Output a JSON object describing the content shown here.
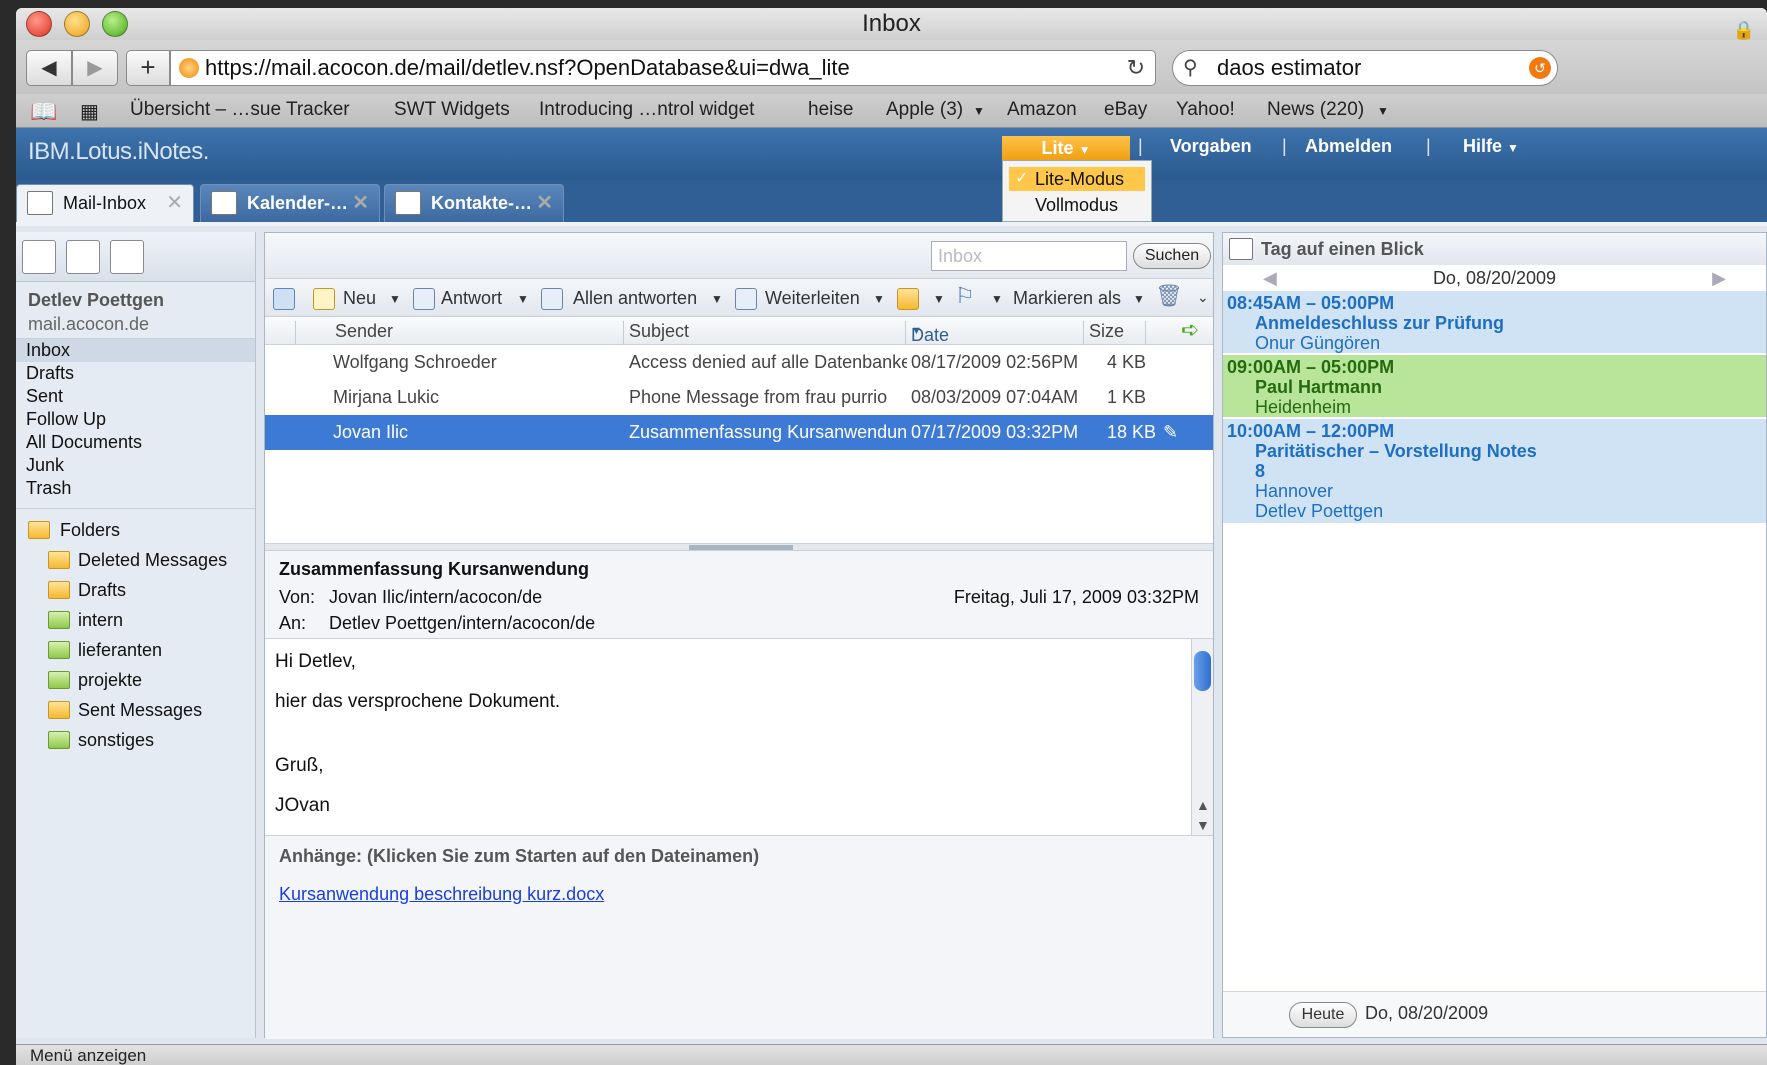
{
  "window": {
    "title": "Inbox"
  },
  "browser": {
    "url": "https://mail.acocon.de/mail/detlev.nsf?OpenDatabase&ui=dwa_lite",
    "search": "daos estimator",
    "bookmarks": [
      "Übersicht – …sue Tracker",
      "SWT Widgets",
      "Introducing …ntrol widget",
      "heise",
      "Apple (3)",
      "Amazon",
      "eBay",
      "Yahoo!",
      "News (220)"
    ]
  },
  "app": {
    "logo": "IBM.Lotus.iNotes.",
    "lite": "Lite",
    "links": {
      "vorgaben": "Vorgaben",
      "abmelden": "Abmelden",
      "hilfe": "Hilfe"
    },
    "lite_menu": {
      "opt1": "Lite-Modus",
      "opt2": "Vollmodus"
    },
    "tabs": [
      "Mail-Inbox",
      "Kalender-…",
      "Kontakte-…"
    ]
  },
  "user": {
    "name": "Detlev Poettgen",
    "domain": "mail.acocon.de"
  },
  "nav": [
    "Inbox",
    "Drafts",
    "Sent",
    "Follow Up",
    "All Documents",
    "Junk",
    "Trash"
  ],
  "folders": {
    "header": "Folders",
    "items": [
      "Deleted Messages",
      "Drafts",
      "intern",
      "lieferanten",
      "projekte",
      "Sent Messages",
      "sonstiges"
    ]
  },
  "search": {
    "placeholder": "Inbox",
    "button": "Suchen"
  },
  "actions": {
    "neu": "Neu",
    "antwort": "Antwort",
    "allen": "Allen antworten",
    "weiter": "Weiterleiten",
    "markieren": "Markieren als"
  },
  "columns": {
    "sender": "Sender",
    "subject": "Subject",
    "date": "Date",
    "size": "Size"
  },
  "messages": [
    {
      "sender": "Wolfgang Schroeder",
      "subject": "Access denied auf alle Datenbanke",
      "date": "08/17/2009 02:56PM",
      "size": "4 KB"
    },
    {
      "sender": "Mirjana Lukic",
      "subject": "Phone Message from frau purrio",
      "date": "08/03/2009 07:04AM",
      "size": "1 KB"
    },
    {
      "sender": "Jovan Ilic",
      "subject": "Zusammenfassung Kursanwendung",
      "date": "07/17/2009 03:32PM",
      "size": "18 KB"
    }
  ],
  "preview": {
    "subject": "Zusammenfassung Kursanwendung",
    "from_label": "Von:",
    "from": "Jovan Ilic/intern/acocon/de",
    "to_label": "An:",
    "to": "Detlev Poettgen/intern/acocon/de",
    "date": "Freitag, Juli 17, 2009 03:32PM",
    "body": [
      "Hi Detlev,",
      "hier das versprochene Dokument.",
      "Gruß,",
      "JOvan"
    ],
    "attach_label": "Anhänge: (Klicken Sie zum Starten auf den Dateinamen)",
    "attach_file": "Kursanwendung beschreibung kurz.docx"
  },
  "calendar": {
    "title": "Tag auf einen Blick",
    "date": "Do, 08/20/2009",
    "events": [
      {
        "time": "08:45AM – 05:00PM",
        "lines": [
          "Anmeldeschluss zur Prüfung",
          "Onur Güngören"
        ]
      },
      {
        "time": "09:00AM – 05:00PM",
        "lines": [
          "Paul Hartmann",
          "Heidenheim"
        ]
      },
      {
        "time": "10:00AM – 12:00PM",
        "lines": [
          "Paritätischer – Vorstellung Notes",
          "8",
          "Hannover",
          "Detlev Poettgen"
        ]
      }
    ],
    "today_button": "Heute",
    "footer_date": "Do, 08/20/2009"
  },
  "status": "Menü anzeigen",
  "colors": {
    "accent": "#2f5f95",
    "selection": "#3d7ad6",
    "lite": "#f0a010"
  }
}
